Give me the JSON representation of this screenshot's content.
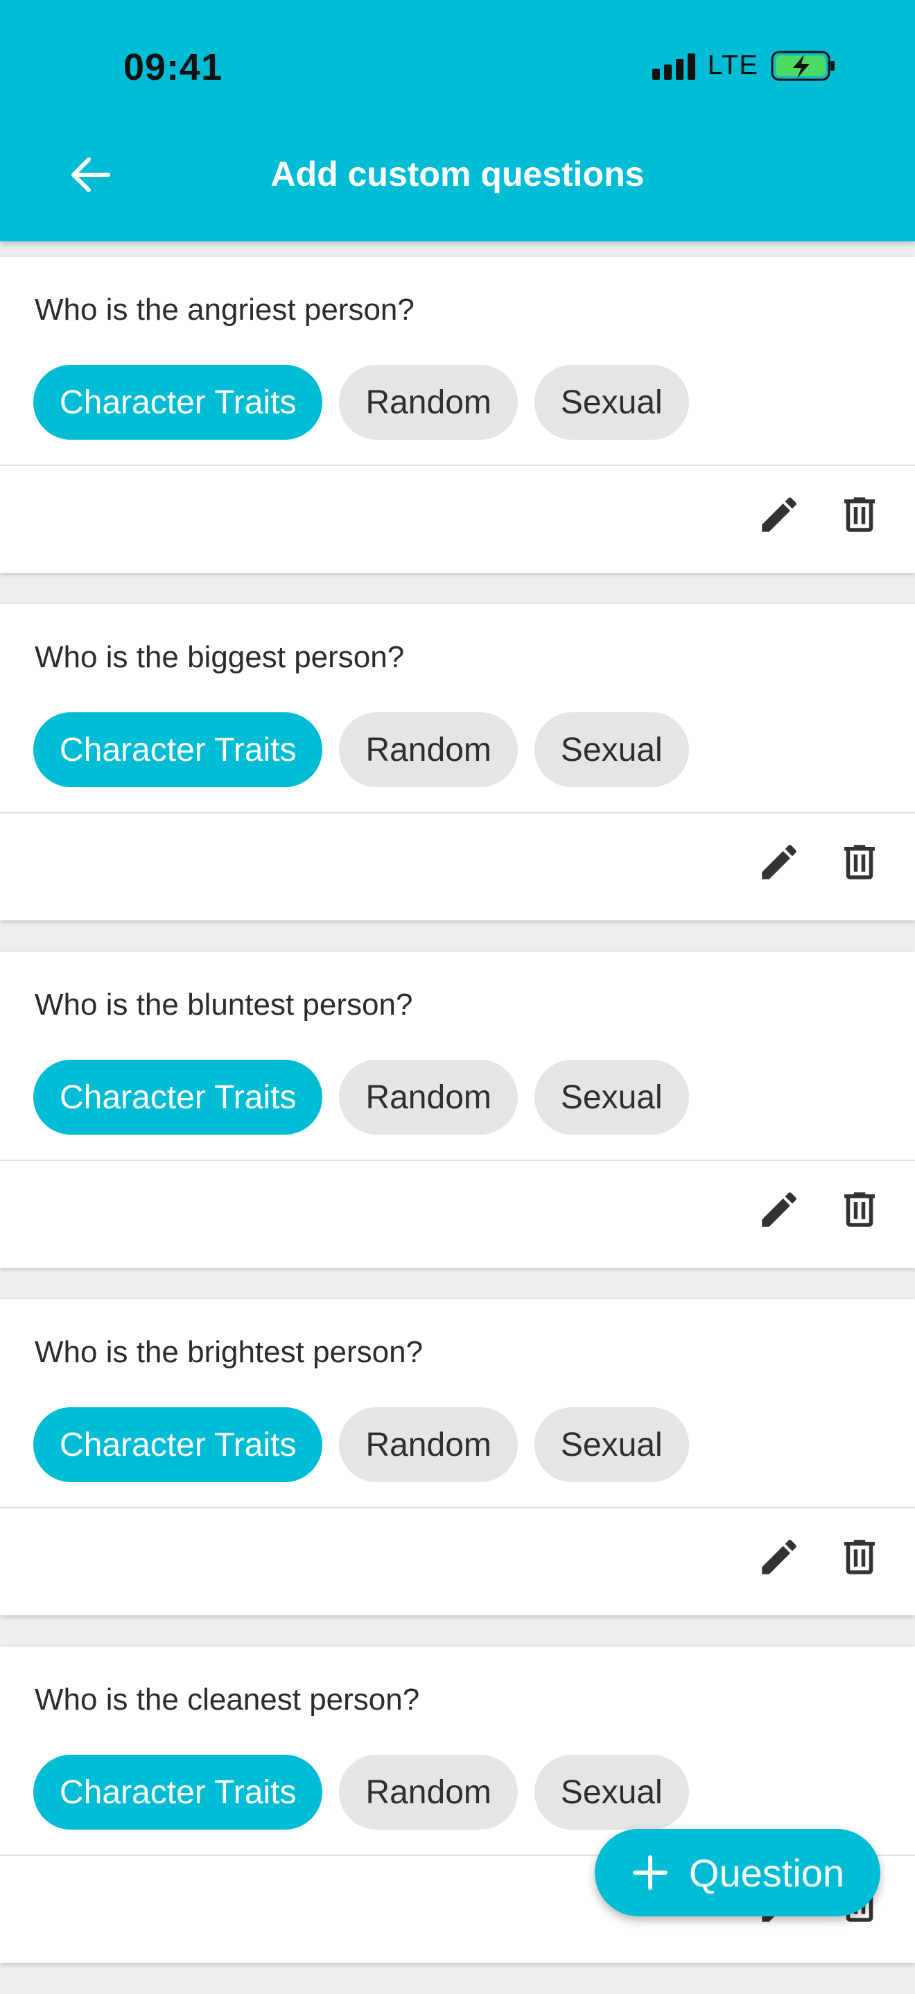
{
  "status_bar": {
    "time": "09:41",
    "network": "LTE"
  },
  "header": {
    "title": "Add custom questions",
    "back_icon": "arrow-left-icon"
  },
  "questions": [
    {
      "text": "Who is the angriest person?",
      "tags": [
        "Character Traits",
        "Random",
        "Sexual"
      ],
      "selected_tag": "Character Traits"
    },
    {
      "text": "Who is the biggest person?",
      "tags": [
        "Character Traits",
        "Random",
        "Sexual"
      ],
      "selected_tag": "Character Traits"
    },
    {
      "text": "Who is the bluntest person?",
      "tags": [
        "Character Traits",
        "Random",
        "Sexual"
      ],
      "selected_tag": "Character Traits"
    },
    {
      "text": "Who is the brightest person?",
      "tags": [
        "Character Traits",
        "Random",
        "Sexual"
      ],
      "selected_tag": "Character Traits"
    },
    {
      "text": "Who is the cleanest person?",
      "tags": [
        "Character Traits",
        "Random",
        "Sexual"
      ],
      "selected_tag": "Character Traits"
    }
  ],
  "fab": {
    "label": "Question",
    "icon": "plus-icon"
  },
  "colors": {
    "accent": "#00bcd4",
    "chip_unselected": "#e4e5e5",
    "background": "#eeeeee",
    "battery_fill": "#4cd964"
  }
}
